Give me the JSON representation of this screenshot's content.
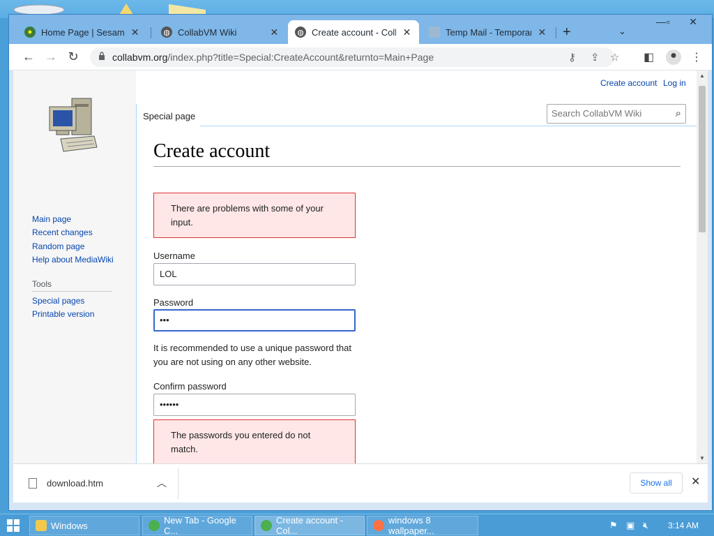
{
  "browser": {
    "tabs": [
      {
        "title": "Home Page | Sesame Street",
        "icon": "sesame-street-icon",
        "active": false
      },
      {
        "title": "CollabVM Wiki",
        "icon": "globe-icon",
        "active": false
      },
      {
        "title": "Create account - CollabVM Wiki",
        "icon": "globe-icon",
        "active": true
      },
      {
        "title": "Temp Mail - Temporary Email",
        "icon": "temp-mail-icon",
        "active": false
      }
    ],
    "new_tab": "+",
    "url_host": "collabvm.org",
    "url_path": "/index.php?title=Special:CreateAccount&returnto=Main+Page"
  },
  "wiki": {
    "personal": {
      "create_account": "Create account",
      "log_in": "Log in"
    },
    "nav": [
      "Main page",
      "Recent changes",
      "Random page",
      "Help about MediaWiki"
    ],
    "tools_heading": "Tools",
    "tools": [
      "Special pages",
      "Printable version"
    ],
    "page_tab": "Special page",
    "search_placeholder": "Search CollabVM Wiki",
    "title": "Create account",
    "error_top": "There are problems with some of your input.",
    "username_label": "Username",
    "username_value": "LOL",
    "password_label": "Password",
    "password_value": "•••",
    "password_hint": "It is recommended to use a unique password that you are not using on any other website.",
    "confirm_label": "Confirm password",
    "confirm_value": "••••••",
    "error_match": "The passwords you entered do not match."
  },
  "downloads": {
    "file": "download.htm",
    "show_all": "Show all"
  },
  "taskbar": {
    "items": [
      {
        "label": "Windows",
        "color": "#f2c94c"
      },
      {
        "label": "New Tab - Google C...",
        "color": "#4caf50"
      },
      {
        "label": "Create account - Col...",
        "color": "#4caf50"
      },
      {
        "label": "windows 8 wallpaper...",
        "color": "#ff7043"
      }
    ],
    "time": "3:14 AM"
  },
  "colors": {
    "link": "#0645ad",
    "error_bg": "#fee7e6",
    "error_border": "#dd3333",
    "focus": "#3366cc"
  }
}
